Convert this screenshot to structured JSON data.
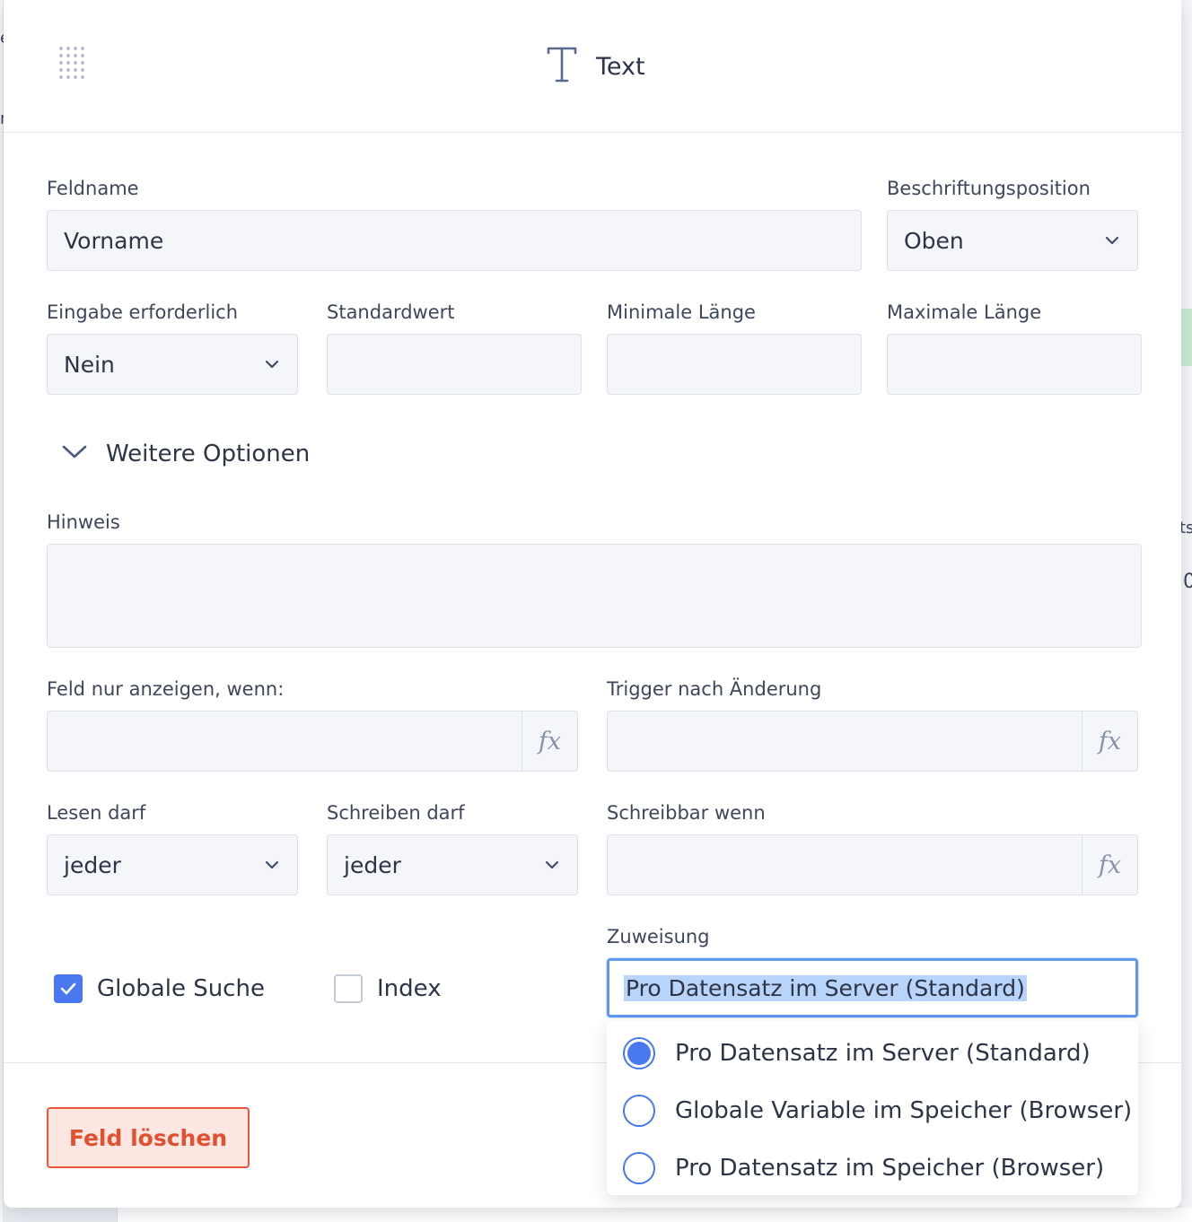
{
  "header": {
    "title": "Text",
    "icon": "text-type-icon"
  },
  "form": {
    "feldname": {
      "label": "Feldname",
      "value": "Vorname"
    },
    "beschriftungsposition": {
      "label": "Beschriftungsposition",
      "value": "Oben"
    },
    "eingabe": {
      "label": "Eingabe erforderlich",
      "value": "Nein"
    },
    "standardwert": {
      "label": "Standardwert",
      "value": ""
    },
    "min_laenge": {
      "label": "Minimale Länge",
      "value": ""
    },
    "max_laenge": {
      "label": "Maximale Länge",
      "value": ""
    },
    "weitere_optionen": "Weitere Optionen",
    "hinweis": {
      "label": "Hinweis",
      "value": ""
    },
    "anzeigen_wenn": {
      "label": "Feld nur anzeigen, wenn:",
      "value": ""
    },
    "trigger": {
      "label": "Trigger nach Änderung",
      "value": ""
    },
    "lesen": {
      "label": "Lesen darf",
      "value": "jeder"
    },
    "schreiben": {
      "label": "Schreiben darf",
      "value": "jeder"
    },
    "schreibbar_wenn": {
      "label": "Schreibbar wenn",
      "value": ""
    },
    "fx_symbol": "fx",
    "globale_suche": {
      "label": "Globale Suche",
      "checked": true
    },
    "index": {
      "label": "Index",
      "checked": false
    },
    "zuweisung": {
      "label": "Zuweisung",
      "value": "Pro Datensatz im Server (Standard)",
      "options": [
        {
          "label": "Pro Datensatz im Server (Standard)",
          "selected": true
        },
        {
          "label": "Globale Variable im Speicher (Browser)",
          "selected": false
        },
        {
          "label": "Pro Datensatz im Speicher (Browser)",
          "selected": false
        }
      ]
    }
  },
  "footer": {
    "delete_label": "Feld löschen"
  },
  "background_fragments": {
    "top_left": "e",
    "left_mid": "n",
    "right_a": "ts",
    "right_b": "0"
  },
  "colors": {
    "accent": "#4a78f0",
    "danger": "#e2502f",
    "field_bg": "#f4f6f9",
    "focus": "#5f97f5"
  }
}
